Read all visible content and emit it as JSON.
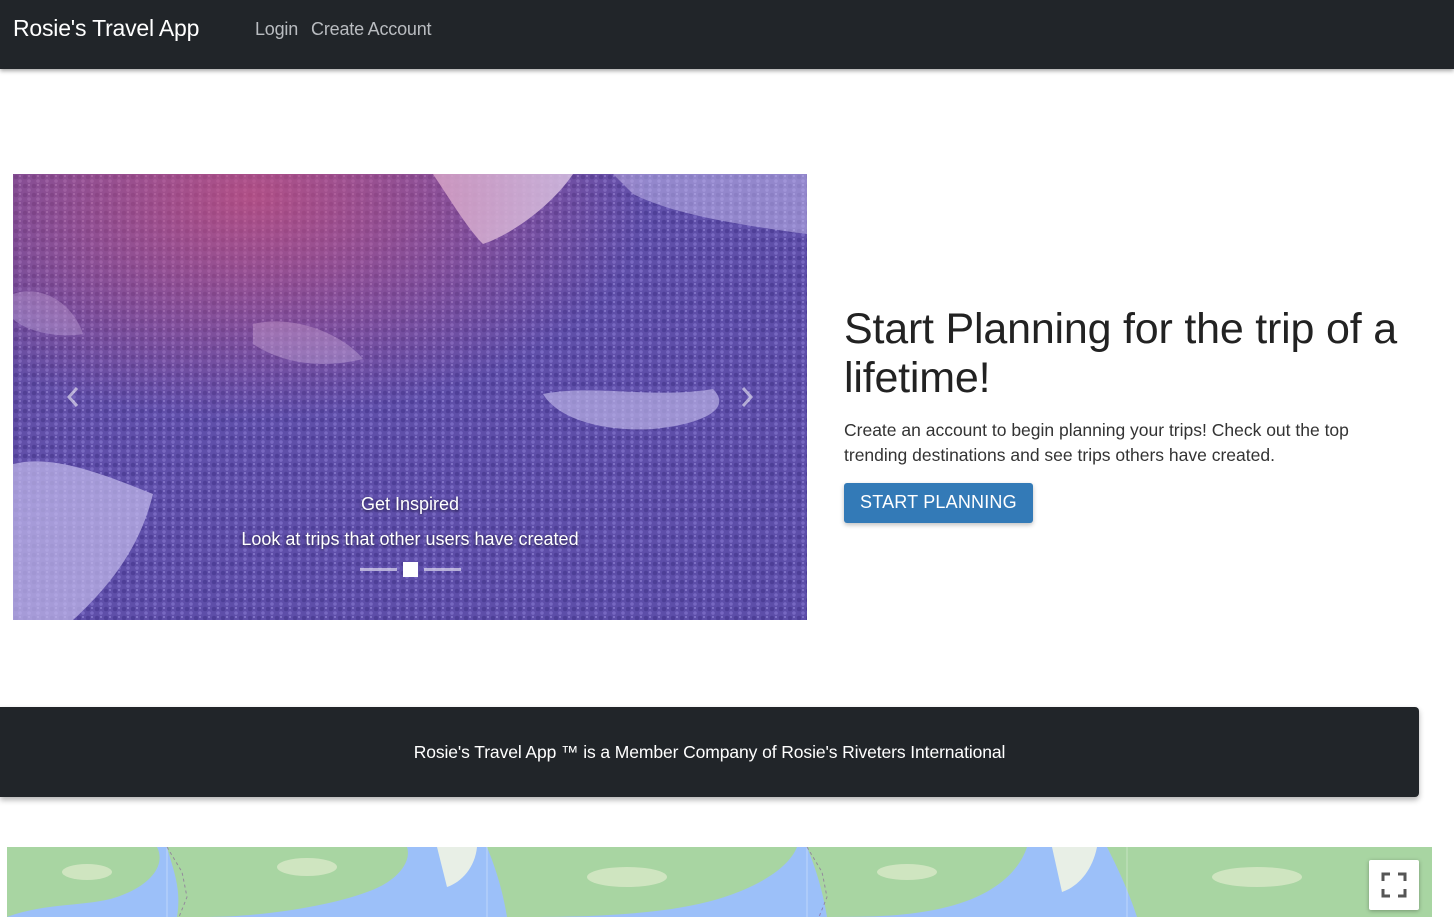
{
  "navbar": {
    "brand": "Rosie's Travel App",
    "links": [
      {
        "label": "Login"
      },
      {
        "label": "Create Account"
      }
    ]
  },
  "carousel": {
    "caption_title": "Get Inspired",
    "caption_subtitle": "Look at trips that other users have created",
    "slide_count": 3,
    "active_slide": 2,
    "prev_icon": "chevron-left-icon",
    "next_icon": "chevron-right-icon"
  },
  "hero": {
    "heading": "Start Planning for the trip of a lifetime!",
    "body": "Create an account to begin planning your trips! Check out the top trending destinations and see trips others have created.",
    "cta_label": "START PLANNING"
  },
  "footer": {
    "text": "Rosie's Travel App ™ is a Member Company of Rosie's Riveters International"
  },
  "map": {
    "fullscreen_icon": "fullscreen-icon"
  },
  "colors": {
    "navbar_bg": "#212529",
    "cta_bg": "#337ab7",
    "carousel_tint": "#6a5ab8",
    "map_water": "#8ab4f8"
  }
}
